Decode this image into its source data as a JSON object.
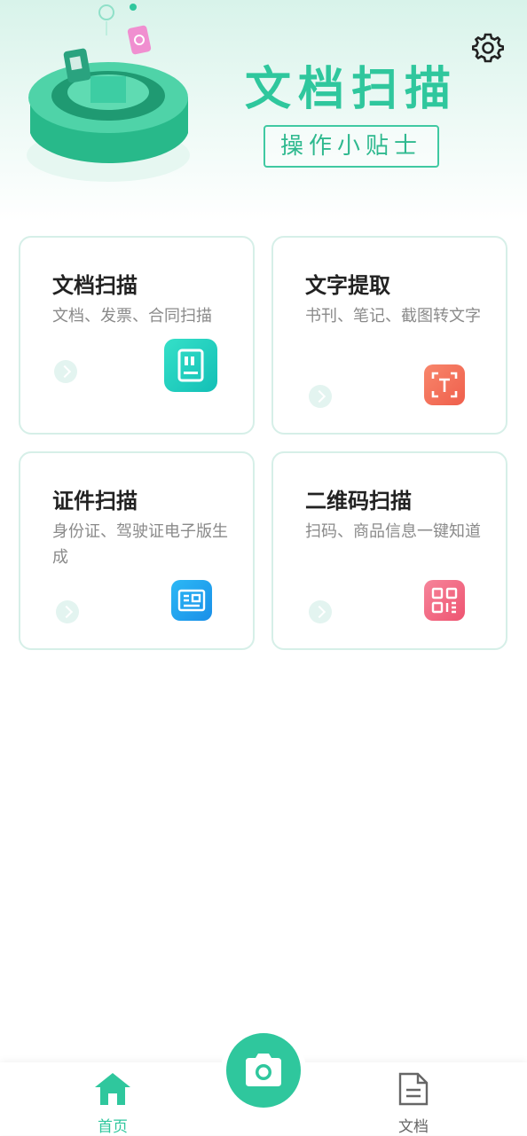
{
  "header": {
    "title": "文档扫描",
    "tips_label": "操作小贴士"
  },
  "cards": [
    {
      "title": "文档扫描",
      "desc": "文档、发票、合同扫描",
      "icon": "document-scan-icon",
      "icon_color": "#22cfc0"
    },
    {
      "title": "文字提取",
      "desc": "书刊、笔记、截图转文字",
      "icon": "text-extract-icon",
      "icon_color": "#f2745b"
    },
    {
      "title": "证件扫描",
      "desc": "身份证、驾驶证电子版生成",
      "icon": "id-card-icon",
      "icon_color": "#1e9ff0"
    },
    {
      "title": "二维码扫描",
      "desc": "扫码、商品信息一键知道",
      "icon": "qr-code-icon",
      "icon_color": "#f1607a"
    }
  ],
  "bottom_nav": {
    "home_label": "首页",
    "docs_label": "文档",
    "active_color": "#2fc79d",
    "inactive_color": "#666666"
  }
}
